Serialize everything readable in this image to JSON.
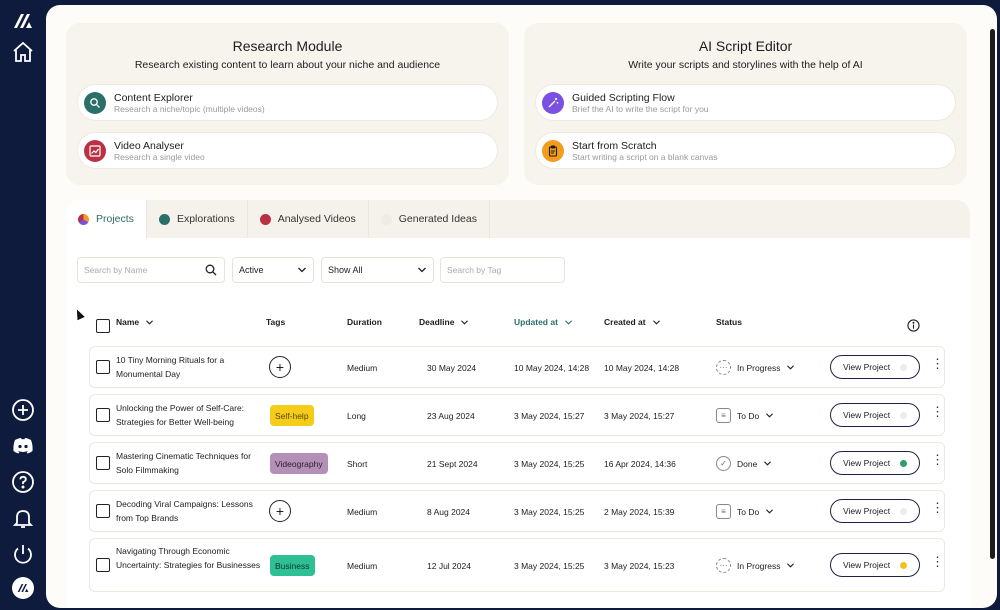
{
  "sidebar": {
    "icons": [
      "logo-icon",
      "home-icon",
      "add-icon",
      "discord-icon",
      "help-icon",
      "bell-icon",
      "power-icon",
      "logo-small-icon"
    ]
  },
  "research": {
    "title": "Research Module",
    "subtitle": "Research existing content to learn about your niche and audience",
    "options": [
      {
        "title": "Content Explorer",
        "subtitle": "Research a niche/topic (multiple videos)",
        "color": "#2c6e6a"
      },
      {
        "title": "Video Analyser",
        "subtitle": "Research a single video",
        "color": "#b83244"
      }
    ]
  },
  "script": {
    "title": "AI Script Editor",
    "subtitle": "Write your scripts and storylines with the help of AI",
    "options": [
      {
        "title": "Guided Scripting Flow",
        "subtitle": "Brief the AI to write the script for you",
        "color": "#7b4fe0"
      },
      {
        "title": "Start from Scratch",
        "subtitle": "Start writing a script on a blank canvas",
        "color": "#f29b1d"
      }
    ]
  },
  "tabs": [
    {
      "label": "Projects",
      "active": true
    },
    {
      "label": "Explorations",
      "active": false
    },
    {
      "label": "Analysed Videos",
      "active": false
    },
    {
      "label": "Generated Ideas",
      "active": false
    }
  ],
  "filters": {
    "search_name_placeholder": "Search by Name",
    "active_value": "Active",
    "show_value": "Show All",
    "search_tag_placeholder": "Search by Tag"
  },
  "table": {
    "headers": {
      "name": "Name",
      "tags": "Tags",
      "duration": "Duration",
      "deadline": "Deadline",
      "updated": "Updated at",
      "created": "Created at",
      "status": "Status"
    },
    "rows": [
      {
        "name": "10 Tiny Morning Rituals for a Monumental Day",
        "tag": "",
        "duration": "Medium",
        "deadline": "30 May 2024",
        "updated": "10 May 2024, 14:28",
        "created": "10 May 2024, 14:28",
        "status": "In Progress",
        "button": "View Project",
        "dot": "#ececec"
      },
      {
        "name": "Unlocking the Power of Self-Care: Strategies for Better Well-being",
        "tag": "Self-help",
        "duration": "Long",
        "deadline": "23 Aug 2024",
        "updated": "3 May 2024, 15:27",
        "created": "3 May 2024, 15:27",
        "status": "To Do",
        "button": "View Project",
        "dot": "#ececec"
      },
      {
        "name": "Mastering Cinematic Techniques for Solo Filmmaking",
        "tag": "Videography",
        "duration": "Short",
        "deadline": "21 Sept 2024",
        "updated": "3 May 2024, 15:25",
        "created": "16 Apr 2024, 14:36",
        "status": "Done",
        "button": "View Project",
        "dot": "#2e9e6a"
      },
      {
        "name": "Decoding Viral Campaigns: Lessons from Top Brands",
        "tag": "",
        "duration": "Medium",
        "deadline": "8 Aug 2024",
        "updated": "3 May 2024, 15:25",
        "created": "2 May 2024, 15:39",
        "status": "To Do",
        "button": "View Project",
        "dot": "#ececec"
      },
      {
        "name": "Navigating Through Economic Uncertainty: Strategies for Businesses",
        "tag": "Business",
        "duration": "Medium",
        "deadline": "12 Jul 2024",
        "updated": "3 May 2024, 15:25",
        "created": "3 May 2024, 15:23",
        "status": "In Progress",
        "button": "View Project",
        "dot": "#f2c21b"
      }
    ]
  },
  "colors": {
    "accent": "#2c6e6a",
    "navy": "#0f1b3d",
    "tag_selfhelp": "#f5cc1a",
    "tag_videography": "#b48fb8",
    "tag_business": "#2fbf94"
  }
}
